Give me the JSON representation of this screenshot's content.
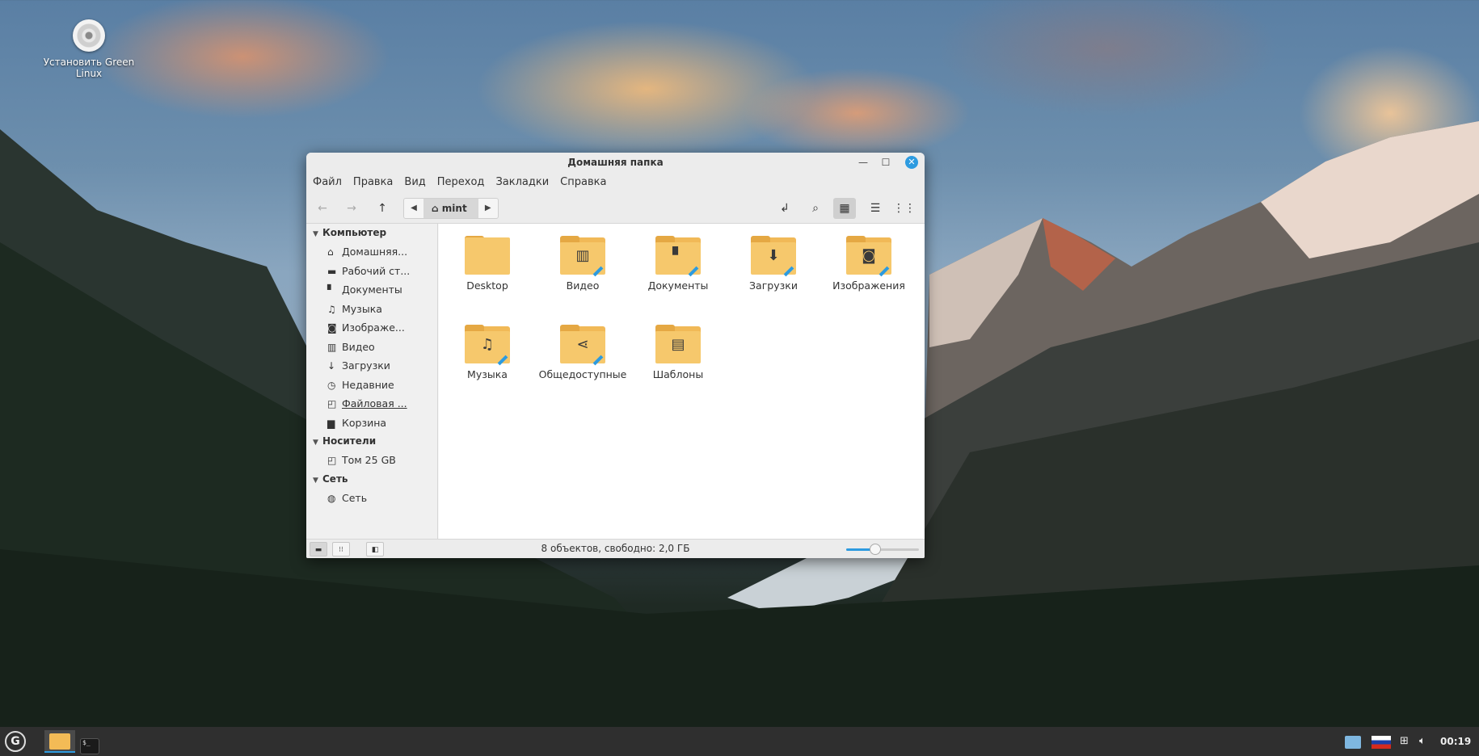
{
  "desktop": {
    "icons": [
      {
        "label": "Установить Green Linux"
      }
    ]
  },
  "window": {
    "title": "Домашняя папка",
    "menu": [
      "Файл",
      "Правка",
      "Вид",
      "Переход",
      "Закладки",
      "Справка"
    ],
    "breadcrumb": {
      "current": "mint"
    },
    "sidebar": {
      "sections": [
        {
          "title": "Компьютер",
          "items": [
            {
              "label": "Домашняя...",
              "icon": "home-icon"
            },
            {
              "label": "Рабочий ст...",
              "icon": "desktop-icon"
            },
            {
              "label": "Документы",
              "icon": "document-icon"
            },
            {
              "label": "Музыка",
              "icon": "music-icon"
            },
            {
              "label": "Изображе...",
              "icon": "camera-icon"
            },
            {
              "label": "Видео",
              "icon": "film-icon"
            },
            {
              "label": "Загрузки",
              "icon": "download-icon"
            },
            {
              "label": "Недавние",
              "icon": "clock-icon"
            },
            {
              "label": "Файловая ...",
              "icon": "drive-icon"
            },
            {
              "label": "Корзина",
              "icon": "trash-icon"
            }
          ]
        },
        {
          "title": "Носители",
          "items": [
            {
              "label": "Том 25 GB",
              "icon": "drive-icon"
            }
          ]
        },
        {
          "title": "Сеть",
          "items": [
            {
              "label": "Сеть",
              "icon": "globe-icon"
            }
          ]
        }
      ]
    },
    "files": [
      {
        "label": "Desktop",
        "icon": "folder-plain"
      },
      {
        "label": "Видео",
        "icon": "film-icon"
      },
      {
        "label": "Документы",
        "icon": "document-icon"
      },
      {
        "label": "Загрузки",
        "icon": "download-icon"
      },
      {
        "label": "Изображения",
        "icon": "camera-icon"
      },
      {
        "label": "Музыка",
        "icon": "music-icon"
      },
      {
        "label": "Общедоступные",
        "icon": "share-icon"
      },
      {
        "label": "Шаблоны",
        "icon": "template-icon"
      }
    ],
    "status": "8 объектов, свободно: 2,0 ГБ",
    "zoom_level": 0.4
  },
  "taskbar": {
    "clock": "00:19"
  },
  "colors": {
    "accent": "#2d9be0",
    "folder": "#f6c86c",
    "taskbar": "#2f2f2f"
  }
}
